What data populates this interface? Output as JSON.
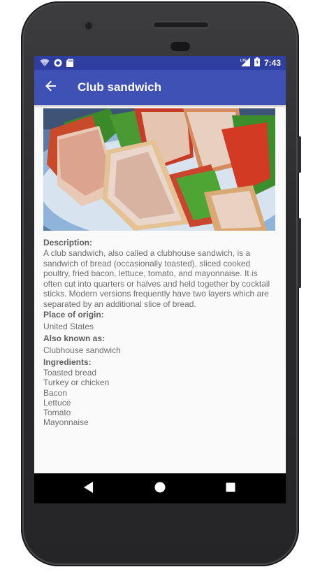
{
  "status_bar": {
    "time": "7:43",
    "network": "LTE"
  },
  "app_bar": {
    "title": "Club sandwich",
    "back_icon": "arrow-back-icon"
  },
  "detail": {
    "image_alt": "club sandwich photo",
    "description_label": "Description:",
    "description": "A club sandwich, also called a clubhouse sandwich, is a sandwich of bread (occasionally toasted), sliced cooked poultry, fried bacon, lettuce, tomato, and mayonnaise. It is often cut into quarters or halves and held together by cocktail sticks. Modern versions frequently have two layers which are separated by an additional slice of bread.",
    "origin_label": "Place of origin:",
    "origin": "United States",
    "aka_label": "Also known as:",
    "aka": "Clubhouse sandwich",
    "ingredients_label": "Ingredients:",
    "ingredients": [
      "Toasted bread",
      "Turkey or chicken",
      "Bacon",
      "Lettuce",
      "Tomato",
      "Mayonnaise"
    ]
  },
  "nav_bar": {
    "back_icon": "triangle-back-icon",
    "home_icon": "circle-home-icon",
    "recents_icon": "square-recents-icon"
  },
  "colors": {
    "primary": "#3f51b5",
    "primary_dark": "#2f3fa1"
  }
}
